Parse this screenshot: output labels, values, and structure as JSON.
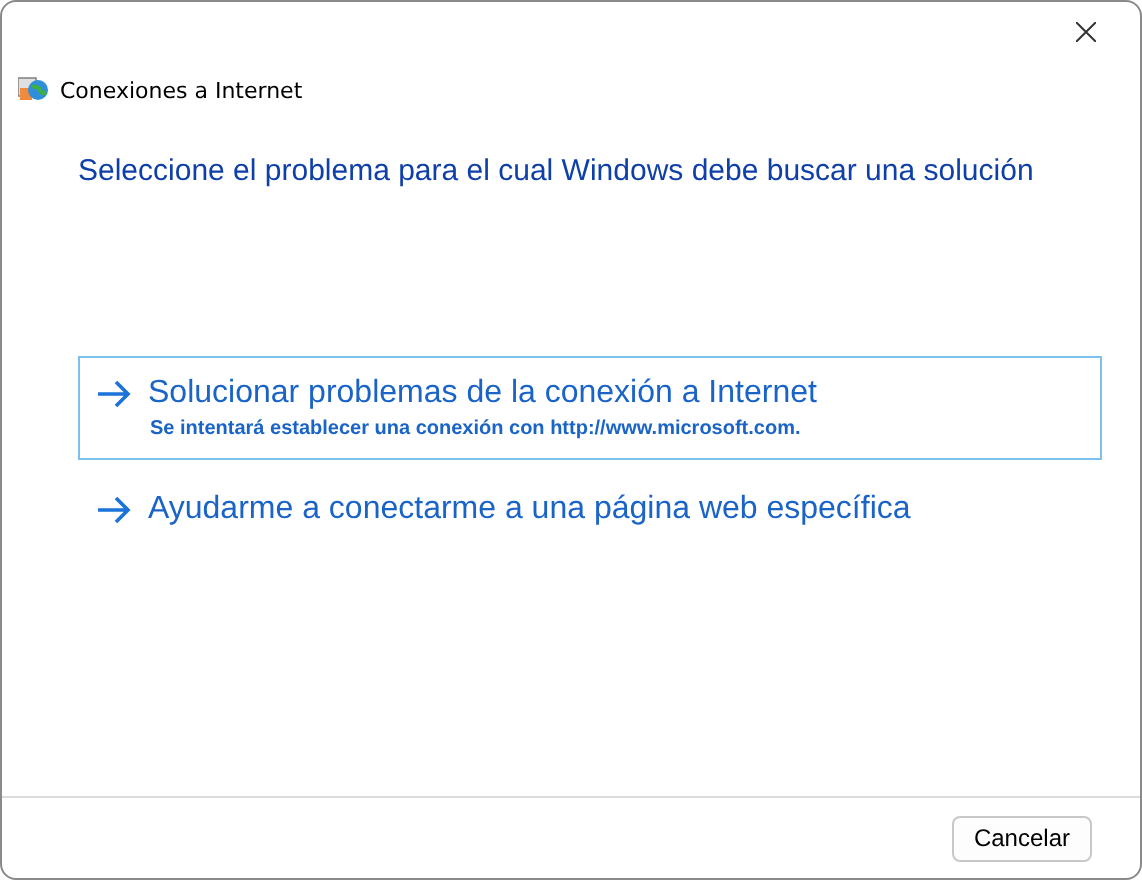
{
  "window": {
    "title": "Conexiones a Internet"
  },
  "heading": "Seleccione el problema para el cual Windows debe buscar una solución",
  "options": [
    {
      "label": "Solucionar problemas de la conexión a Internet",
      "description": "Se intentará establecer una conexión con http://www.microsoft.com.",
      "selected": true
    },
    {
      "label": "Ayudarme a conectarme a una página web específica",
      "selected": false
    }
  ],
  "buttons": [
    "Cancelar"
  ]
}
